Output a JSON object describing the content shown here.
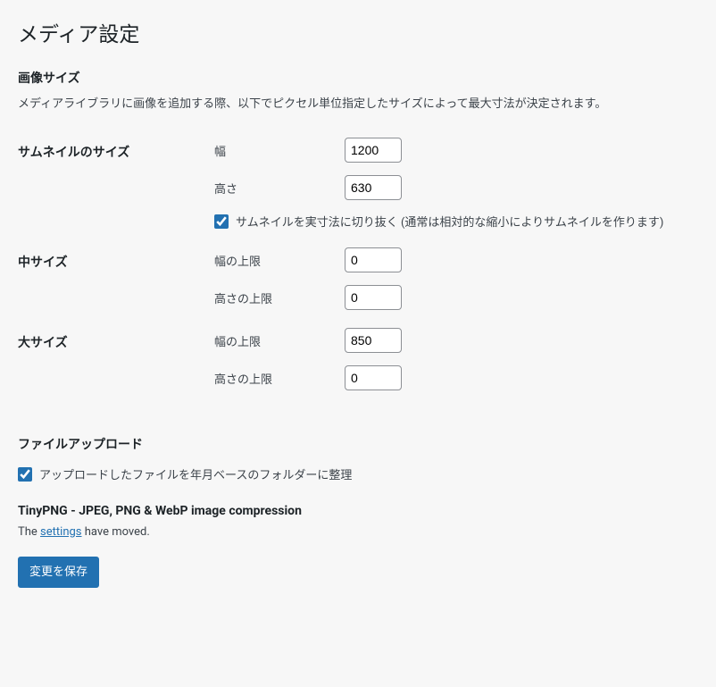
{
  "page_title": "メディア設定",
  "section_image_sizes": {
    "heading": "画像サイズ",
    "description": "メディアライブラリに画像を追加する際、以下でピクセル単位指定したサイズによって最大寸法が決定されます。"
  },
  "thumbnail": {
    "row_label": "サムネイルのサイズ",
    "width_label": "幅",
    "width_value": "1200",
    "height_label": "高さ",
    "height_value": "630",
    "crop_label": "サムネイルを実寸法に切り抜く (通常は相対的な縮小によりサムネイルを作ります)",
    "crop_checked": true
  },
  "medium": {
    "row_label": "中サイズ",
    "width_label": "幅の上限",
    "width_value": "0",
    "height_label": "高さの上限",
    "height_value": "0"
  },
  "large": {
    "row_label": "大サイズ",
    "width_label": "幅の上限",
    "width_value": "850",
    "height_label": "高さの上限",
    "height_value": "0"
  },
  "section_upload": {
    "heading": "ファイルアップロード",
    "organize_label": "アップロードしたファイルを年月ベースのフォルダーに整理",
    "organize_checked": true
  },
  "tinypng": {
    "heading": "TinyPNG - JPEG, PNG & WebP image compression",
    "msg_before": "The ",
    "msg_link": "settings",
    "msg_after": " have moved."
  },
  "submit_label": "変更を保存"
}
